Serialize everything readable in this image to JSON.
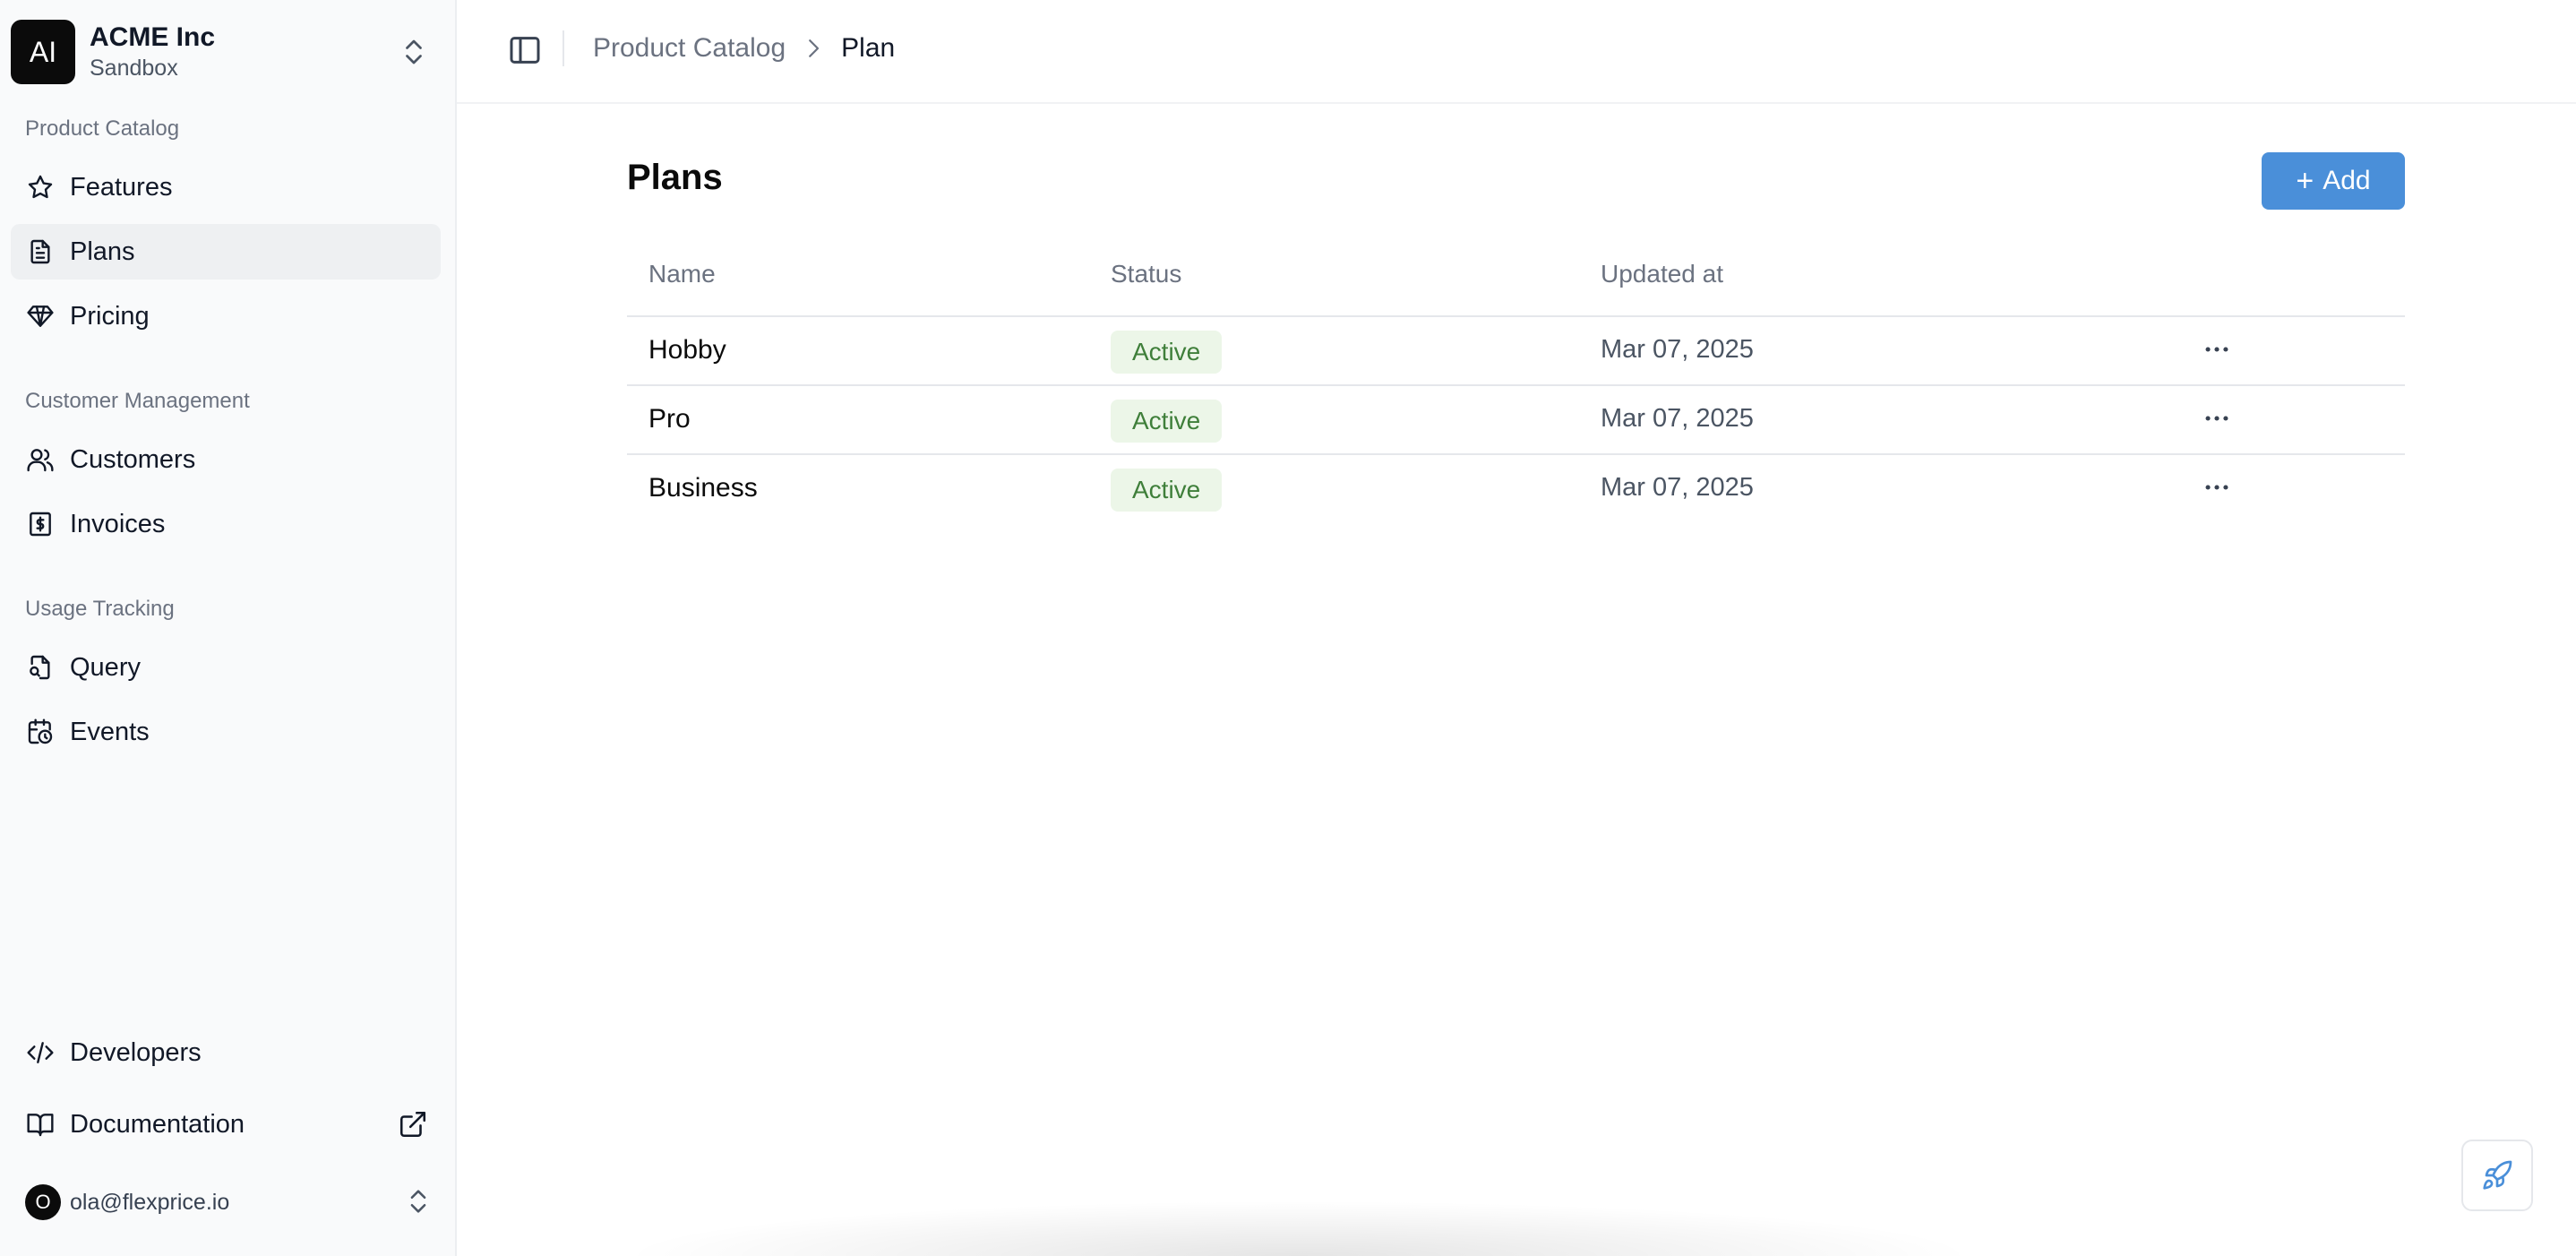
{
  "org": {
    "avatar_initials": "AI",
    "name": "ACME Inc",
    "environment": "Sandbox"
  },
  "sidebar": {
    "sections": [
      {
        "label": "Product Catalog",
        "items": [
          {
            "label": "Features",
            "icon": "star-icon"
          },
          {
            "label": "Plans",
            "icon": "document-icon",
            "active": true
          },
          {
            "label": "Pricing",
            "icon": "diamond-icon"
          }
        ]
      },
      {
        "label": "Customer Management",
        "items": [
          {
            "label": "Customers",
            "icon": "users-icon"
          },
          {
            "label": "Invoices",
            "icon": "invoice-icon"
          }
        ]
      },
      {
        "label": "Usage Tracking",
        "items": [
          {
            "label": "Query",
            "icon": "file-search-icon"
          },
          {
            "label": "Events",
            "icon": "calendar-clock-icon"
          }
        ]
      }
    ],
    "footer_items": [
      {
        "label": "Developers",
        "icon": "code-icon"
      },
      {
        "label": "Documentation",
        "icon": "book-icon",
        "external": true
      }
    ],
    "user": {
      "avatar_initial": "O",
      "email": "ola@flexprice.io"
    }
  },
  "breadcrumb": {
    "parent": "Product Catalog",
    "current": "Plan"
  },
  "page": {
    "title": "Plans",
    "add_button_label": "Add"
  },
  "table": {
    "columns": [
      "Name",
      "Status",
      "Updated at"
    ],
    "rows": [
      {
        "name": "Hobby",
        "status": "Active",
        "updated_at": "Mar 07, 2025"
      },
      {
        "name": "Pro",
        "status": "Active",
        "updated_at": "Mar 07, 2025"
      },
      {
        "name": "Business",
        "status": "Active",
        "updated_at": "Mar 07, 2025"
      }
    ]
  },
  "colors": {
    "accent": "#4a8fd9",
    "status_active_bg": "#ecf6e8",
    "status_active_text": "#3f7f3a",
    "sidebar_bg": "#f9fafb"
  }
}
